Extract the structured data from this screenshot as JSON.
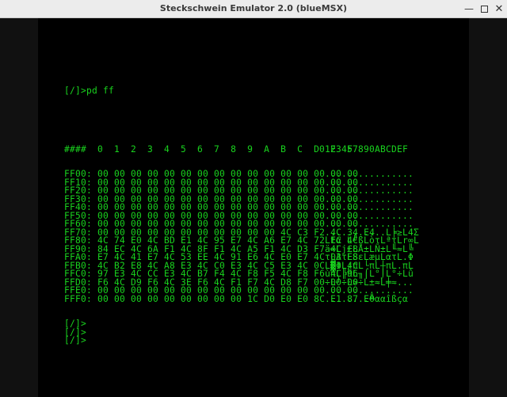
{
  "window": {
    "title": "Steckschwein Emulator 2.0 (blueMSX)",
    "controls": [
      "minimize",
      "maximize",
      "close"
    ],
    "min_glyph": "—",
    "close_glyph": "✕"
  },
  "colors": {
    "text": "#19d31e",
    "background": "#000000"
  },
  "terminal": {
    "command": "[/]>pd ff",
    "header": {
      "addr": "####",
      "hex": " 0  1  2  3  4  5  6  7  8  9  A  B  C  D  E  F",
      "ascii": "0123457890ABCDEF"
    },
    "rows": [
      {
        "addr": "FF00:",
        "hex": "00 00 00 00 00 00 00 00 00 00 00 00 00 00 00 00",
        "ascii": "................"
      },
      {
        "addr": "FF10:",
        "hex": "00 00 00 00 00 00 00 00 00 00 00 00 00 00 00 00",
        "ascii": "................"
      },
      {
        "addr": "FF20:",
        "hex": "00 00 00 00 00 00 00 00 00 00 00 00 00 00 00 00",
        "ascii": "................"
      },
      {
        "addr": "FF30:",
        "hex": "00 00 00 00 00 00 00 00 00 00 00 00 00 00 00 00",
        "ascii": "................"
      },
      {
        "addr": "FF40:",
        "hex": "00 00 00 00 00 00 00 00 00 00 00 00 00 00 00 00",
        "ascii": "................"
      },
      {
        "addr": "FF50:",
        "hex": "00 00 00 00 00 00 00 00 00 00 00 00 00 00 00 00",
        "ascii": "................"
      },
      {
        "addr": "FF60:",
        "hex": "00 00 00 00 00 00 00 00 00 00 00 00 00 00 00 00",
        "ascii": "................"
      },
      {
        "addr": "FF70:",
        "hex": "00 00 00 00 00 00 00 00 00 00 00 4C C3 F2 4C 34 E4",
        "ascii": "...........L╞≥L4Σ"
      },
      {
        "addr": "FF80:",
        "hex": "4C 74 E0 4C BD E1 4C 95 E7 4C A6 E7 4C 72 EC 4C",
        "ascii": "Ltα L╜ßLòτLªτLr∞L"
      },
      {
        "addr": "FF90:",
        "hex": "84 EC 4C 6A F1 4C 8F F1 4C A5 F1 4C D3 F7 4C C8",
        "ascii": "ä∞Lj±LÅ±LÑ±L╙≈L╚"
      },
      {
        "addr": "FFA0:",
        "hex": "E7 4C 41 E7 4C 53 EE 4C 91 E6 4C E0 E7 4C 03 E8",
        "ascii": "τLAτLSεLæµLατL.Φ"
      },
      {
        "addr": "FFB0:",
        "hex": "4C B2 E8 4C A8 E3 4C C0 E3 4C C5 E3 4C 0C E3 4C",
        "ascii": "L▓ΦL¿πL└πL┼πL.πL"
      },
      {
        "addr": "FFC0:",
        "hex": "97 E3 4C CC E3 4C B7 F4 4C F8 F5 4C F8 F6 4C 96",
        "ascii": "ùπL╠πL╖⌠L°⌡L°÷Lû"
      },
      {
        "addr": "FFD0:",
        "hex": "F6 4C D9 F6 4C 3E F6 4C F1 F7 4C D8 F7 00 00 00",
        "ascii": "÷L┘÷L>÷L±≈L╪≈..."
      },
      {
        "addr": "FFE0:",
        "hex": "00 00 00 00 00 00 00 00 00 00 00 00 00 00 00 00",
        "ascii": "................"
      },
      {
        "addr": "FFF0:",
        "hex": "00 00 00 00 00 00 00 00 00 1C D0 E0 E0 8C E1 87 E0",
        "ascii": "........╨ααîßçα"
      }
    ],
    "prompts": [
      "[/]>",
      "[/]>",
      "[/]>"
    ]
  }
}
